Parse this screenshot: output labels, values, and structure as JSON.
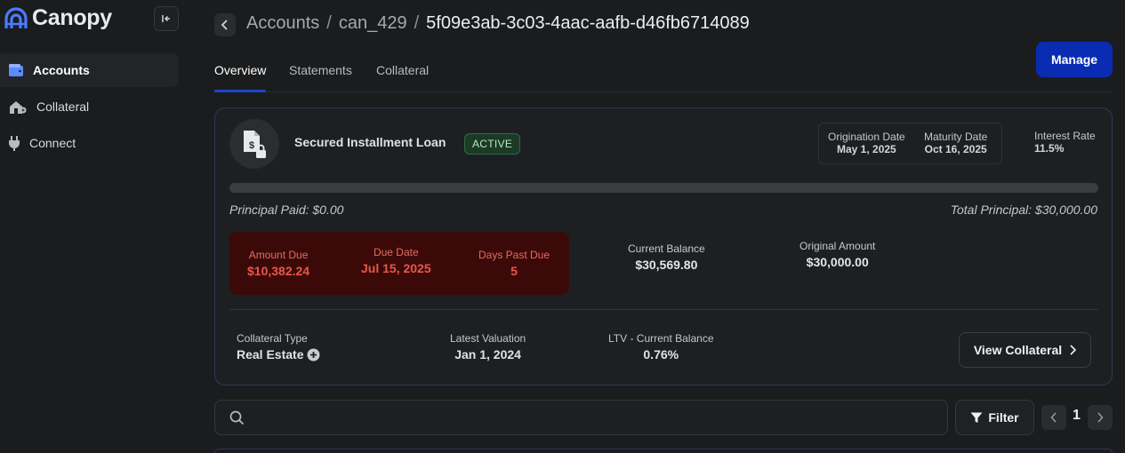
{
  "app": {
    "name": "Canopy"
  },
  "sidebar": {
    "items": [
      {
        "label": "Accounts",
        "icon": "wallet-icon",
        "active": true
      },
      {
        "label": "Collateral",
        "icon": "house-icon",
        "active": false
      },
      {
        "label": "Connect",
        "icon": "plug-icon",
        "active": false
      }
    ]
  },
  "breadcrumb": {
    "items": [
      "Accounts",
      "can_429",
      "5f09e3ab-3c03-4aac-aafb-d46fb6714089"
    ],
    "separator": "/"
  },
  "header": {
    "manage_label": "Manage"
  },
  "tabs": [
    {
      "label": "Overview",
      "active": true
    },
    {
      "label": "Statements",
      "active": false
    },
    {
      "label": "Collateral",
      "active": false
    }
  ],
  "loan": {
    "title": "Secured Installment Loan",
    "status": "ACTIVE",
    "origination_date_label": "Origination Date",
    "origination_date": "May 1, 2025",
    "maturity_date_label": "Maturity Date",
    "maturity_date": "Oct 16, 2025",
    "interest_rate_label": "Interest Rate",
    "interest_rate": "11.5%",
    "principal_paid": "Principal Paid: $0.00",
    "total_principal": "Total Principal: $30,000.00",
    "principal_progress": 0
  },
  "due": {
    "amount_due_label": "Amount Due",
    "amount_due": "$10,382.24",
    "due_date_label": "Due Date",
    "due_date": "Jul 15, 2025",
    "days_past_due_label": "Days Past Due",
    "days_past_due": "5"
  },
  "balances": {
    "current_balance_label": "Current Balance",
    "current_balance": "$30,569.80",
    "original_amount_label": "Original Amount",
    "original_amount": "$30,000.00"
  },
  "collateral": {
    "type_label": "Collateral Type",
    "type": "Real Estate",
    "valuation_label": "Latest Valuation",
    "valuation": "Jan 1, 2024",
    "ltv_label": "LTV - Current Balance",
    "ltv": "0.76%",
    "view_label": "View Collateral"
  },
  "search": {
    "placeholder": ""
  },
  "filter": {
    "label": "Filter"
  },
  "pagination": {
    "page": "1"
  },
  "colors": {
    "accent": "#0a2cb3",
    "tab_underline": "#1f46c7",
    "status_green": "#1c3a26",
    "due_bg": "#3b0a08",
    "due_text": "#e8564a",
    "logo_blue": "#4b7bff"
  }
}
